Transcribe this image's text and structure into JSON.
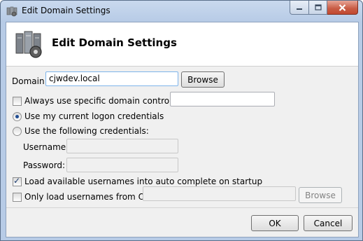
{
  "window": {
    "title": "Edit Domain Settings"
  },
  "header": {
    "title": "Edit Domain Settings"
  },
  "domain": {
    "label": "Domain:",
    "value": "cjwdev.local",
    "browse_label": "Browse"
  },
  "dc": {
    "label": "Always use specific domain controller:",
    "checked": false,
    "value": ""
  },
  "credentials": {
    "current_label": "Use my current logon credentials",
    "following_label": "Use the following credentials:",
    "selected": "current",
    "username_label": "Username:",
    "username_value": "",
    "password_label": "Password:",
    "password_value": ""
  },
  "autocomplete": {
    "label": "Load available usernames into auto complete on startup",
    "checked": true
  },
  "ou": {
    "label": "Only load usernames from OU:",
    "checked": false,
    "value": "",
    "browse_label": "Browse"
  },
  "buttons": {
    "ok": "OK",
    "cancel": "Cancel"
  }
}
